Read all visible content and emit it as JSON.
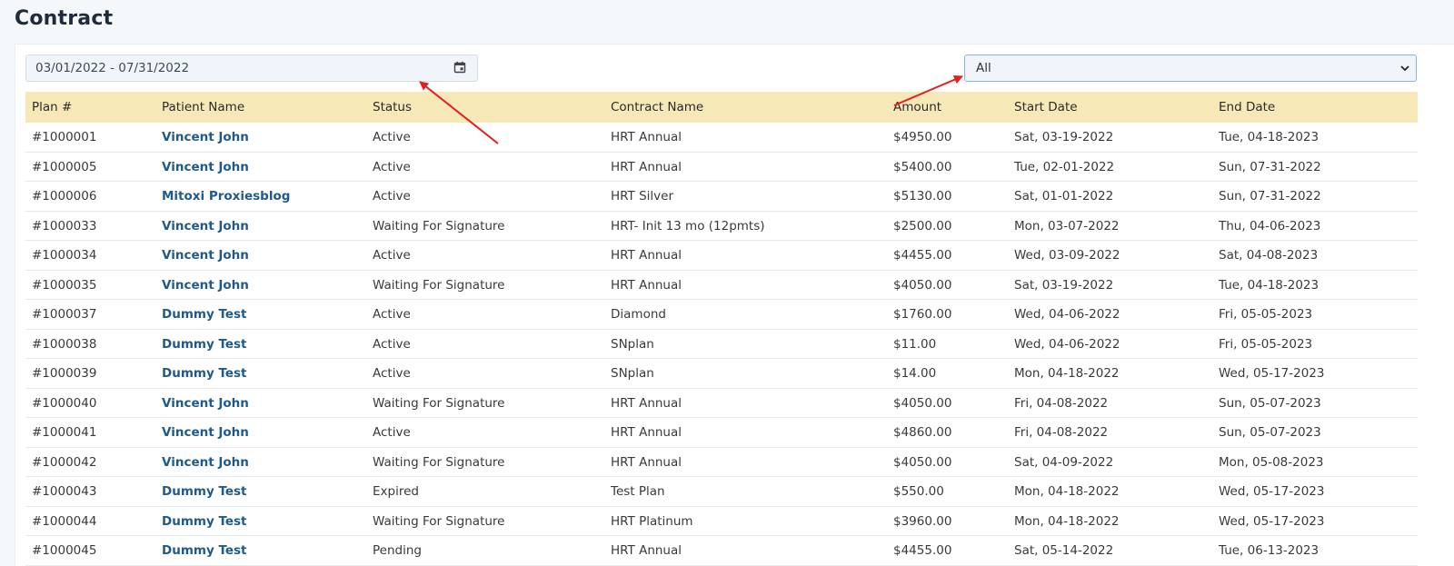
{
  "page": {
    "title": "Contract"
  },
  "filters": {
    "date_range": "03/01/2022 - 07/31/2022",
    "status_select": "All"
  },
  "icons": {
    "calendar": "calendar-icon",
    "select_caret": "chevron-down-icon"
  },
  "colors": {
    "header_bg": "#f7e9b7",
    "link": "#1f5a8a",
    "annotation_arrow": "#e81c1c"
  },
  "table": {
    "columns": [
      "Plan #",
      "Patient Name",
      "Status",
      "Contract Name",
      "Amount",
      "Start Date",
      "End Date"
    ],
    "rows": [
      [
        "#1000001",
        "Vincent John",
        "Active",
        "HRT Annual",
        "$4950.00",
        "Sat, 03-19-2022",
        "Tue, 04-18-2023"
      ],
      [
        "#1000005",
        "Vincent John",
        "Active",
        "HRT Annual",
        "$5400.00",
        "Tue, 02-01-2022",
        "Sun, 07-31-2022"
      ],
      [
        "#1000006",
        "Mitoxi Proxiesblog",
        "Active",
        "HRT Silver",
        "$5130.00",
        "Sat, 01-01-2022",
        "Sun, 07-31-2022"
      ],
      [
        "#1000033",
        "Vincent John",
        "Waiting For Signature",
        "HRT- Init 13 mo (12pmts)",
        "$2500.00",
        "Mon, 03-07-2022",
        "Thu, 04-06-2023"
      ],
      [
        "#1000034",
        "Vincent John",
        "Active",
        "HRT Annual",
        "$4455.00",
        "Wed, 03-09-2022",
        "Sat, 04-08-2023"
      ],
      [
        "#1000035",
        "Vincent John",
        "Waiting For Signature",
        "HRT Annual",
        "$4050.00",
        "Sat, 03-19-2022",
        "Tue, 04-18-2023"
      ],
      [
        "#1000037",
        "Dummy Test",
        "Active",
        "Diamond",
        "$1760.00",
        "Wed, 04-06-2022",
        "Fri, 05-05-2023"
      ],
      [
        "#1000038",
        "Dummy Test",
        "Active",
        "SNplan",
        "$11.00",
        "Wed, 04-06-2022",
        "Fri, 05-05-2023"
      ],
      [
        "#1000039",
        "Dummy Test",
        "Active",
        "SNplan",
        "$14.00",
        "Mon, 04-18-2022",
        "Wed, 05-17-2023"
      ],
      [
        "#1000040",
        "Vincent John",
        "Waiting For Signature",
        "HRT Annual",
        "$4050.00",
        "Fri, 04-08-2022",
        "Sun, 05-07-2023"
      ],
      [
        "#1000041",
        "Vincent John",
        "Active",
        "HRT Annual",
        "$4860.00",
        "Fri, 04-08-2022",
        "Sun, 05-07-2023"
      ],
      [
        "#1000042",
        "Vincent John",
        "Waiting For Signature",
        "HRT Annual",
        "$4050.00",
        "Sat, 04-09-2022",
        "Mon, 05-08-2023"
      ],
      [
        "#1000043",
        "Dummy Test",
        "Expired",
        "Test Plan",
        "$550.00",
        "Mon, 04-18-2022",
        "Wed, 05-17-2023"
      ],
      [
        "#1000044",
        "Dummy Test",
        "Waiting For Signature",
        "HRT Platinum",
        "$3960.00",
        "Mon, 04-18-2022",
        "Wed, 05-17-2023"
      ],
      [
        "#1000045",
        "Dummy Test",
        "Pending",
        "HRT Annual",
        "$4455.00",
        "Sat, 05-14-2022",
        "Tue, 06-13-2023"
      ]
    ]
  }
}
